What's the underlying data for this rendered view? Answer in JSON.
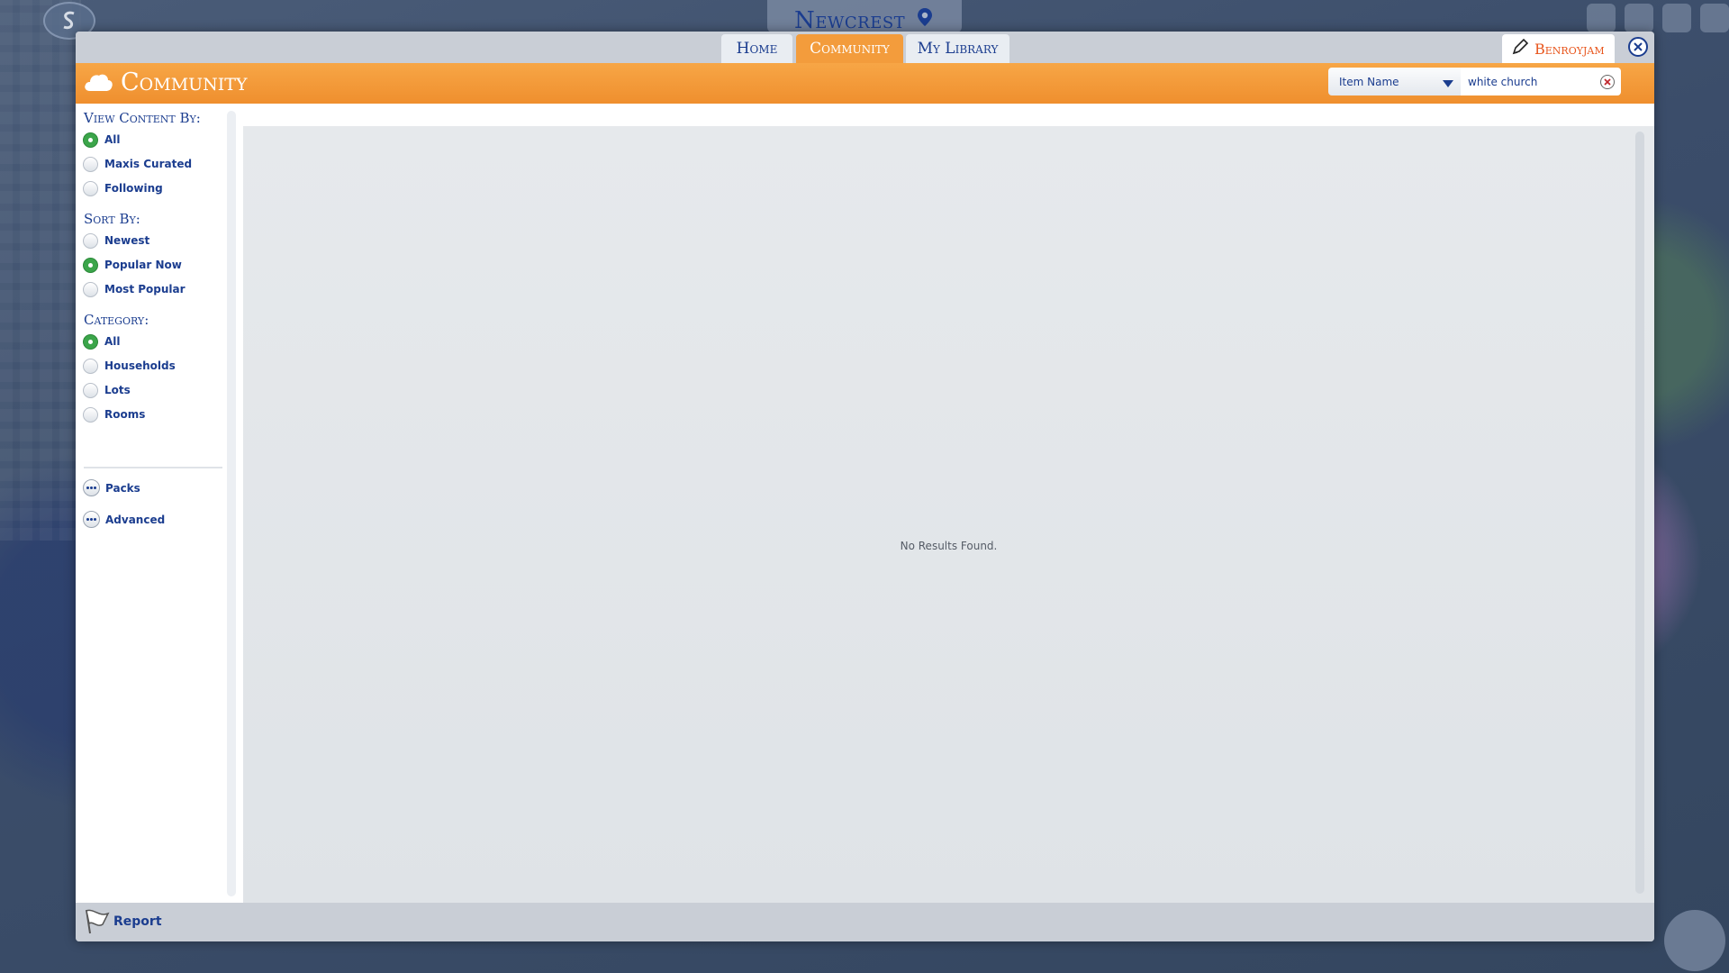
{
  "world": {
    "name": "Newcrest"
  },
  "tabs": [
    {
      "label": "Home"
    },
    {
      "label": "Community"
    },
    {
      "label": "My Library"
    }
  ],
  "user": {
    "name": "Benroyjam"
  },
  "header": {
    "title": "Community"
  },
  "search": {
    "type_selected": "Item Name",
    "query": "white church"
  },
  "filters": {
    "view_title": "View Content By:",
    "view_options": [
      {
        "label": "All",
        "selected": true
      },
      {
        "label": "Maxis Curated",
        "selected": false
      },
      {
        "label": "Following",
        "selected": false
      }
    ],
    "sort_title": "Sort By:",
    "sort_options": [
      {
        "label": "Newest",
        "selected": false
      },
      {
        "label": "Popular Now",
        "selected": true
      },
      {
        "label": "Most Popular",
        "selected": false
      }
    ],
    "category_title": "Category:",
    "category_options": [
      {
        "label": "All",
        "selected": true
      },
      {
        "label": "Households",
        "selected": false
      },
      {
        "label": "Lots",
        "selected": false
      },
      {
        "label": "Rooms",
        "selected": false
      }
    ],
    "packs_label": "Packs",
    "advanced_label": "Advanced"
  },
  "results": {
    "message": "No Results Found."
  },
  "footer": {
    "report_label": "Report"
  },
  "colors": {
    "accent": "#f39c3c",
    "text": "#1b3d8f",
    "selected": "#3ba54a",
    "user": "#e8561d"
  }
}
